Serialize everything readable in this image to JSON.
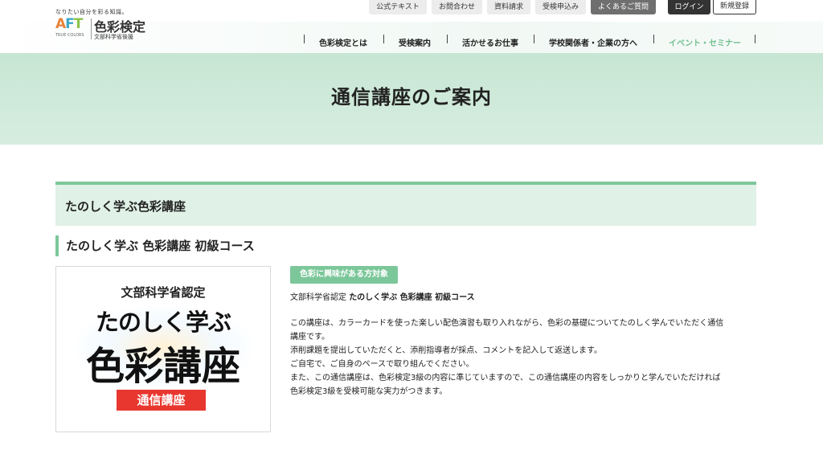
{
  "utility_nav": [
    "公式テキスト",
    "お問合わせ",
    "資料請求",
    "受検申込み",
    "よくあるご質問"
  ],
  "auth": {
    "login": "ログイン",
    "signup": "新規登録"
  },
  "logo": {
    "tagline": "なりたい自分を彩る知識。",
    "aft": {
      "a": "A",
      "f": "F",
      "t": "T"
    },
    "truecolors": "TRUE COLORS",
    "name": "色彩検定",
    "sub": "文部科学省後援"
  },
  "main_nav": [
    {
      "label": "色彩検定とは",
      "active": false
    },
    {
      "label": "受検案内",
      "active": false
    },
    {
      "label": "活かせるお仕事",
      "active": false
    },
    {
      "label": "学校関係者・企業の方へ",
      "active": false
    },
    {
      "label": "イベント・セミナー",
      "active": true
    }
  ],
  "hero": {
    "title": "通信講座のご案内"
  },
  "section": {
    "title": "たのしく学ぶ色彩講座"
  },
  "course": {
    "title": "たのしく学ぶ 色彩講座 初級コース",
    "image": {
      "top": "文部科学省認定",
      "mid": "たのしく学ぶ",
      "big": "色彩講座",
      "badge": "通信講座"
    },
    "tag": "色彩に興味がある方対象",
    "desc_head_prefix": "文部科学省認定 ",
    "desc_head_bold": "たのしく学ぶ 色彩講座 初級コース",
    "description": [
      "この講座は、カラーカードを使った楽しい配色演習も取り入れながら、色彩の基礎についてたのしく学んでいただく通信",
      "講座です。",
      "添削課題を提出していただくと、添削指導者が採点、コメントを記入して返送します。",
      "ご自宅で、ご自身のペースで取り組んでください。",
      "また、この通信講座は、色彩検定3級の内容に準じていますので、この通信講座の内容をしっかりと学んでいただければ",
      "色彩検定3級を受検可能な実力がつきます。"
    ]
  },
  "colors": {
    "accent_green": "#7cc79a",
    "hero_bg": "#c7e6d3",
    "badge_red": "#e8372f"
  }
}
